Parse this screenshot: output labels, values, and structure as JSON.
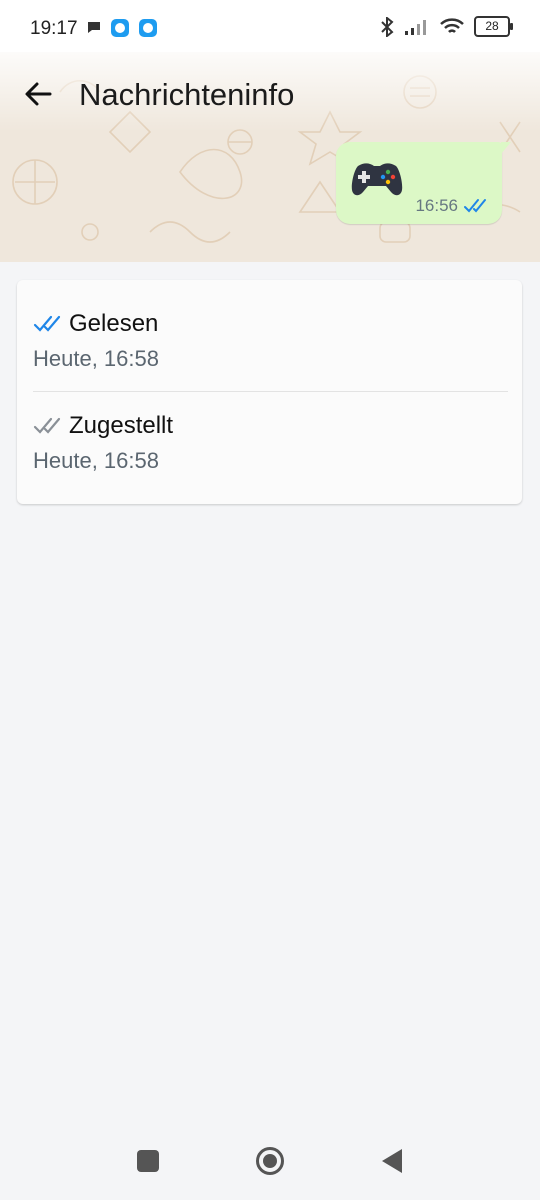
{
  "status_bar": {
    "time": "19:17",
    "battery": "28"
  },
  "header": {
    "title": "Nachrichteninfo",
    "back_icon": "arrow-left-icon"
  },
  "message": {
    "emoji": "game-controller",
    "time": "16:56",
    "status_icon": "double-check-read-icon"
  },
  "receipts": {
    "read": {
      "label": "Gelesen",
      "time": "Heute, 16:58",
      "color": "#1f86e8"
    },
    "delivered": {
      "label": "Zugestellt",
      "time": "Heute, 16:58",
      "color": "#8a9097"
    }
  },
  "colors": {
    "bubble": "#dcf8c6",
    "read_check": "#1f86e8",
    "wallpaper": "#efe7dc"
  }
}
